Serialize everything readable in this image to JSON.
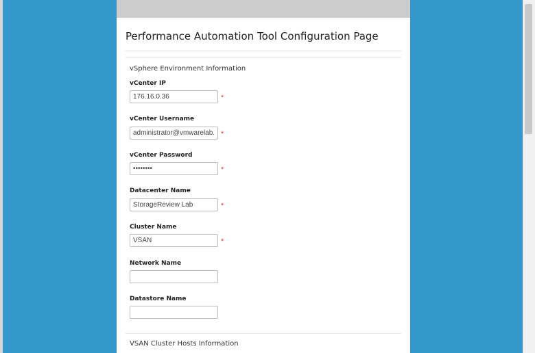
{
  "page": {
    "title": "Performance Automation Tool Configuration Page"
  },
  "sections": {
    "vsphere": "vSphere Environment Information",
    "vsan": "VSAN Cluster Hosts Information"
  },
  "fields": [
    {
      "label": "vCenter IP",
      "value": "176.16.0.36",
      "required_mark": "*"
    },
    {
      "label": "vCenter Username",
      "value": "administrator@vmwarelab.local",
      "required_mark": "*"
    },
    {
      "label": "vCenter Password",
      "value": "••••••••",
      "required_mark": "*"
    },
    {
      "label": "Datacenter Name",
      "value": "StorageReview Lab",
      "required_mark": "*"
    },
    {
      "label": "Cluster Name",
      "value": "VSAN",
      "required_mark": "*"
    },
    {
      "label": "Network Name",
      "value": ""
    },
    {
      "label": "Datastore Name",
      "value": ""
    }
  ],
  "colors": {
    "background": "#3399cc",
    "required": "#e03a3a"
  }
}
